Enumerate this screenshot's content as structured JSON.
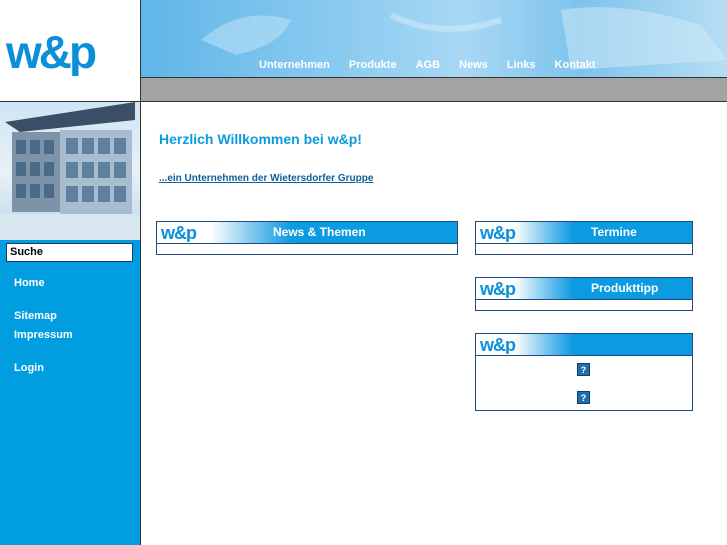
{
  "brand": {
    "logo_text": "w&p",
    "colors": {
      "accent": "#009de0",
      "dark": "#1f4b80",
      "grey_bar": "#a3a3a3"
    }
  },
  "header": {
    "nav": [
      "Unternehmen",
      "Produkte",
      "AGB",
      "News",
      "Links",
      "Kontakt"
    ]
  },
  "sidebar": {
    "search_label": "Suche",
    "links": {
      "home": "Home",
      "sitemap": "Sitemap",
      "impressum": "Impressum",
      "login": "Login"
    }
  },
  "main": {
    "welcome": "Herzlich Willkommen bei w&p!",
    "group_link": "...ein Unternehmen der Wietersdorfer Gruppe",
    "boxes": {
      "news": {
        "title": "News & Themen",
        "logo": "w&p"
      },
      "termine": {
        "title": "Termine",
        "logo": "w&p"
      },
      "produkttipp": {
        "title": "Produkttipp",
        "logo": "w&p"
      },
      "extra": {
        "title": "",
        "logo": "w&p",
        "icons": [
          "?",
          "?"
        ]
      }
    }
  }
}
